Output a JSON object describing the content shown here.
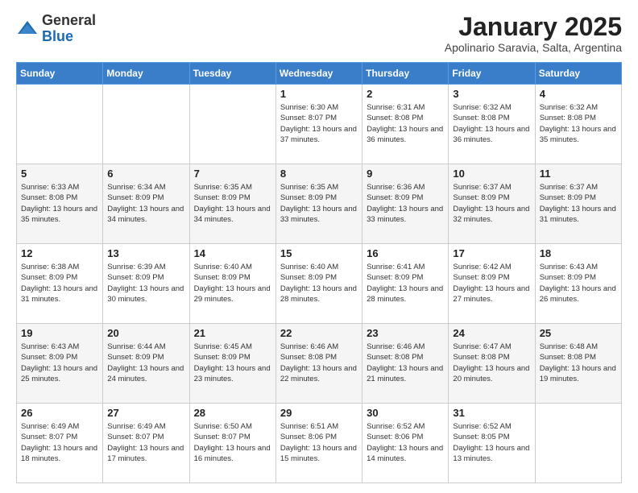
{
  "logo": {
    "general": "General",
    "blue": "Blue"
  },
  "header": {
    "month": "January 2025",
    "location": "Apolinario Saravia, Salta, Argentina"
  },
  "weekdays": [
    "Sunday",
    "Monday",
    "Tuesday",
    "Wednesday",
    "Thursday",
    "Friday",
    "Saturday"
  ],
  "weeks": [
    [
      {
        "day": "",
        "info": ""
      },
      {
        "day": "",
        "info": ""
      },
      {
        "day": "",
        "info": ""
      },
      {
        "day": "1",
        "info": "Sunrise: 6:30 AM\nSunset: 8:07 PM\nDaylight: 13 hours and 37 minutes."
      },
      {
        "day": "2",
        "info": "Sunrise: 6:31 AM\nSunset: 8:08 PM\nDaylight: 13 hours and 36 minutes."
      },
      {
        "day": "3",
        "info": "Sunrise: 6:32 AM\nSunset: 8:08 PM\nDaylight: 13 hours and 36 minutes."
      },
      {
        "day": "4",
        "info": "Sunrise: 6:32 AM\nSunset: 8:08 PM\nDaylight: 13 hours and 35 minutes."
      }
    ],
    [
      {
        "day": "5",
        "info": "Sunrise: 6:33 AM\nSunset: 8:08 PM\nDaylight: 13 hours and 35 minutes."
      },
      {
        "day": "6",
        "info": "Sunrise: 6:34 AM\nSunset: 8:09 PM\nDaylight: 13 hours and 34 minutes."
      },
      {
        "day": "7",
        "info": "Sunrise: 6:35 AM\nSunset: 8:09 PM\nDaylight: 13 hours and 34 minutes."
      },
      {
        "day": "8",
        "info": "Sunrise: 6:35 AM\nSunset: 8:09 PM\nDaylight: 13 hours and 33 minutes."
      },
      {
        "day": "9",
        "info": "Sunrise: 6:36 AM\nSunset: 8:09 PM\nDaylight: 13 hours and 33 minutes."
      },
      {
        "day": "10",
        "info": "Sunrise: 6:37 AM\nSunset: 8:09 PM\nDaylight: 13 hours and 32 minutes."
      },
      {
        "day": "11",
        "info": "Sunrise: 6:37 AM\nSunset: 8:09 PM\nDaylight: 13 hours and 31 minutes."
      }
    ],
    [
      {
        "day": "12",
        "info": "Sunrise: 6:38 AM\nSunset: 8:09 PM\nDaylight: 13 hours and 31 minutes."
      },
      {
        "day": "13",
        "info": "Sunrise: 6:39 AM\nSunset: 8:09 PM\nDaylight: 13 hours and 30 minutes."
      },
      {
        "day": "14",
        "info": "Sunrise: 6:40 AM\nSunset: 8:09 PM\nDaylight: 13 hours and 29 minutes."
      },
      {
        "day": "15",
        "info": "Sunrise: 6:40 AM\nSunset: 8:09 PM\nDaylight: 13 hours and 28 minutes."
      },
      {
        "day": "16",
        "info": "Sunrise: 6:41 AM\nSunset: 8:09 PM\nDaylight: 13 hours and 28 minutes."
      },
      {
        "day": "17",
        "info": "Sunrise: 6:42 AM\nSunset: 8:09 PM\nDaylight: 13 hours and 27 minutes."
      },
      {
        "day": "18",
        "info": "Sunrise: 6:43 AM\nSunset: 8:09 PM\nDaylight: 13 hours and 26 minutes."
      }
    ],
    [
      {
        "day": "19",
        "info": "Sunrise: 6:43 AM\nSunset: 8:09 PM\nDaylight: 13 hours and 25 minutes."
      },
      {
        "day": "20",
        "info": "Sunrise: 6:44 AM\nSunset: 8:09 PM\nDaylight: 13 hours and 24 minutes."
      },
      {
        "day": "21",
        "info": "Sunrise: 6:45 AM\nSunset: 8:09 PM\nDaylight: 13 hours and 23 minutes."
      },
      {
        "day": "22",
        "info": "Sunrise: 6:46 AM\nSunset: 8:08 PM\nDaylight: 13 hours and 22 minutes."
      },
      {
        "day": "23",
        "info": "Sunrise: 6:46 AM\nSunset: 8:08 PM\nDaylight: 13 hours and 21 minutes."
      },
      {
        "day": "24",
        "info": "Sunrise: 6:47 AM\nSunset: 8:08 PM\nDaylight: 13 hours and 20 minutes."
      },
      {
        "day": "25",
        "info": "Sunrise: 6:48 AM\nSunset: 8:08 PM\nDaylight: 13 hours and 19 minutes."
      }
    ],
    [
      {
        "day": "26",
        "info": "Sunrise: 6:49 AM\nSunset: 8:07 PM\nDaylight: 13 hours and 18 minutes."
      },
      {
        "day": "27",
        "info": "Sunrise: 6:49 AM\nSunset: 8:07 PM\nDaylight: 13 hours and 17 minutes."
      },
      {
        "day": "28",
        "info": "Sunrise: 6:50 AM\nSunset: 8:07 PM\nDaylight: 13 hours and 16 minutes."
      },
      {
        "day": "29",
        "info": "Sunrise: 6:51 AM\nSunset: 8:06 PM\nDaylight: 13 hours and 15 minutes."
      },
      {
        "day": "30",
        "info": "Sunrise: 6:52 AM\nSunset: 8:06 PM\nDaylight: 13 hours and 14 minutes."
      },
      {
        "day": "31",
        "info": "Sunrise: 6:52 AM\nSunset: 8:05 PM\nDaylight: 13 hours and 13 minutes."
      },
      {
        "day": "",
        "info": ""
      }
    ]
  ]
}
